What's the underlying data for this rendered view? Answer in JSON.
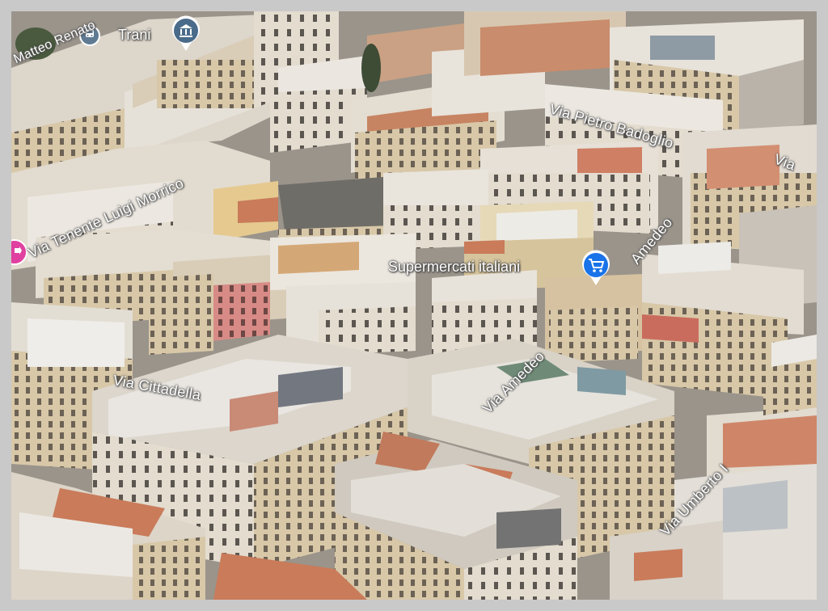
{
  "map": {
    "view": "3D satellite",
    "streets": [
      {
        "id": "matteo",
        "name": "Matteo Renato"
      },
      {
        "id": "tenente",
        "name": "Via Tenente Luigi Morrico"
      },
      {
        "id": "badoglio",
        "name": "Via Pietro Badoglio"
      },
      {
        "id": "via-right",
        "name": "Via"
      },
      {
        "id": "amedeo-top",
        "name": "Amedeo"
      },
      {
        "id": "cittadella",
        "name": "Via Cittadella"
      },
      {
        "id": "amedeo",
        "name": "Via Amedeo"
      },
      {
        "id": "umberto",
        "name": "Via Umberto I"
      }
    ],
    "places": [
      {
        "id": "trani",
        "name": "Trani",
        "icon": "museum-icon",
        "color": "#4a6b8a"
      },
      {
        "id": "supermercati",
        "name": "Supermercati italiani",
        "icon": "shopping-cart-icon",
        "color": "#1a73e8"
      }
    ],
    "colors": {
      "frame": "#c9c9c9",
      "roof_light": "#e9e6e0",
      "roof_terracotta": "#c97b5a",
      "wall_beige": "#d9c9aa",
      "street": "#8f8f8f",
      "pin_blue": "#1a73e8",
      "pin_pink": "#e040a0",
      "transit": "#5f7a92"
    }
  }
}
